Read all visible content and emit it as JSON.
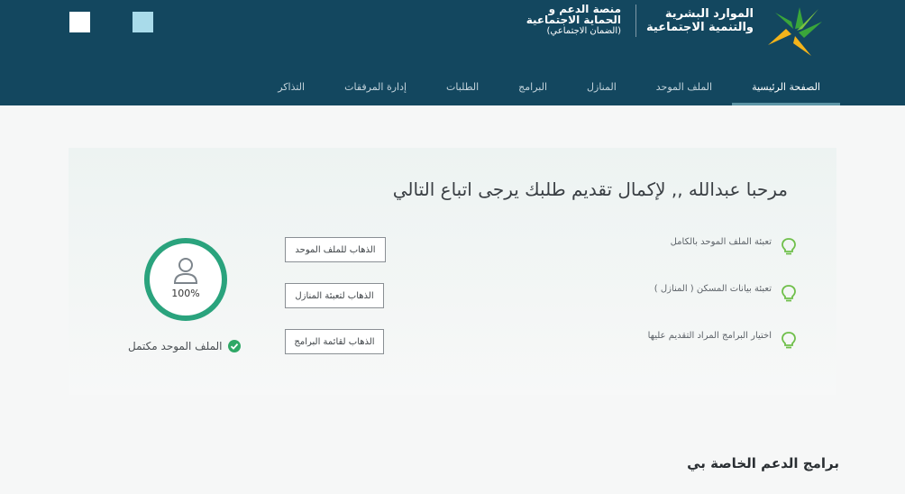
{
  "header": {
    "ministry_line1": "الموارد البشرية",
    "ministry_line2": "والتنمية الاجتماعية",
    "platform_line1": "منصة الدعم و",
    "platform_line2": "الحماية الاجتماعية",
    "platform_sub": "(الضمان الاجتماعي)"
  },
  "nav": {
    "items": [
      {
        "label": "الصفحة الرئيسية",
        "active": true
      },
      {
        "label": "الملف الموحد"
      },
      {
        "label": "المنازل"
      },
      {
        "label": "البرامج"
      },
      {
        "label": "الطلبات"
      },
      {
        "label": "إدارة المرفقات"
      },
      {
        "label": "التذاكر"
      }
    ]
  },
  "main": {
    "welcome": "مرحبا عبدالله ,, لإكمال تقديم طلبك يرجى اتباع التالي",
    "steps": [
      {
        "text": "تعبئة الملف الموحد بالكامل",
        "button": "الذهاب للملف الموحد"
      },
      {
        "text": "تعبئة بيانات المسكن ( المنازل )",
        "button": "الذهاب لتعبئة المنازل"
      },
      {
        "text": "اختيار البرامج المراد التقديم عليها",
        "button": "الذهاب لقائمة البرامج"
      }
    ],
    "progress_percent": "100%",
    "progress_fraction": 1.0,
    "profile_status": "الملف الموحد مكتمل"
  },
  "programs_heading": "برامج الدعم الخاصة بي",
  "colors": {
    "header_bg": "#13475f",
    "accent_green": "#2aa37d",
    "check_green": "#2fa866",
    "logo_green": "#3aa63a",
    "logo_yellow": "#f4b41a"
  },
  "icons": [
    "lightbulb-icon",
    "user-icon",
    "check-circle-icon",
    "ministry-logo"
  ]
}
